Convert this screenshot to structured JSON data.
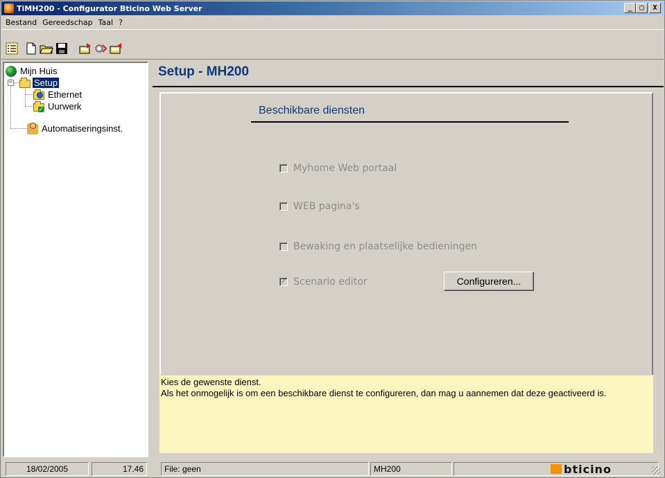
{
  "window": {
    "title": "TiMH200 - Configurator Bticino Web Server",
    "controls": {
      "minimize": "_",
      "maximize": "□",
      "close": "X"
    }
  },
  "menu": [
    "Bestand",
    "Gereedschap",
    "Taal",
    "?"
  ],
  "toolbar": {
    "buttons": [
      "list-icon",
      "new-document-icon",
      "open-folder-icon",
      "save-icon",
      "export-icon",
      "settings-transfer-icon",
      "import-icon"
    ]
  },
  "tree": {
    "root": "Mijn Huis",
    "setup": "Setup",
    "ethernet": "Ethernet",
    "uurwerk": "Uurwerk",
    "automation": "Automatiseringsinst."
  },
  "main": {
    "page_title": "Setup - MH200",
    "services_title": "Beschikbare diensten",
    "services": [
      {
        "label": "Myhome Web portaal",
        "checked": false
      },
      {
        "label": "WEB pagina's",
        "checked": false
      },
      {
        "label": "Bewaking en plaatselijke bedieningen",
        "checked": false
      },
      {
        "label": "Scenario editor",
        "checked": true
      }
    ],
    "configure_button": "Configureren...",
    "help_line1": "Kies de gewenste dienst.",
    "help_line2": "Als het onmogelijk is om een beschikbare dienst te configureren, dan mag u aannemen dat deze geactiveerd is."
  },
  "status": {
    "date": "18/02/2005",
    "time": "17.46",
    "file": "File: geen",
    "device": "MH200",
    "logo": "bticino"
  },
  "colors": {
    "accent_title": "#0a3a7e",
    "help_background": "#fbf6c0",
    "logo_orange": "#f39200"
  }
}
